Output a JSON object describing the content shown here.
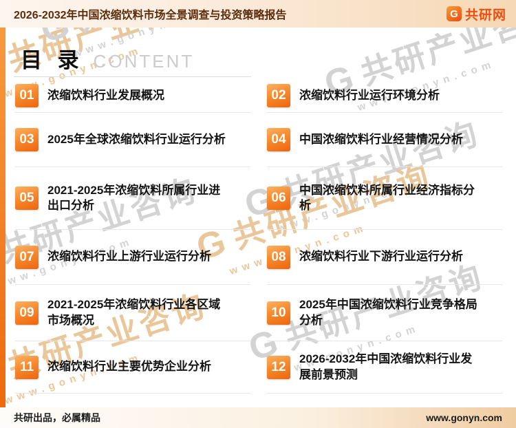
{
  "header": {
    "title": "2026-2032年中国浓缩饮料市场全景调查与投资策略报告",
    "logo_glyph": "G",
    "brand": "共研网"
  },
  "toc": {
    "heading": "目 录",
    "heading_en": "CONTENT",
    "items": [
      {
        "num": "01",
        "label": "浓缩饮料行业发展概况"
      },
      {
        "num": "02",
        "label": "浓缩饮料行业运行环境分析"
      },
      {
        "num": "03",
        "label": "2025年全球浓缩饮料行业运行分析"
      },
      {
        "num": "04",
        "label": "中国浓缩饮料行业经营情况分析"
      },
      {
        "num": "05",
        "label": "2021-2025年浓缩饮料所属行业进出口分析"
      },
      {
        "num": "06",
        "label": "中国浓缩饮料所属行业经济指标分析"
      },
      {
        "num": "07",
        "label": "浓缩饮料行业上游行业运行分析"
      },
      {
        "num": "08",
        "label": "浓缩饮料行业下游行业运行分析"
      },
      {
        "num": "09",
        "label": "2021-2025年浓缩饮料行业各区域市场概况"
      },
      {
        "num": "10",
        "label": "2025年中国浓缩饮料行业竞争格局分析"
      },
      {
        "num": "11",
        "label": "浓缩饮料行业主要优势企业分析"
      },
      {
        "num": "12",
        "label": "2026-2032年中国浓缩饮料行业发展前景预测"
      }
    ]
  },
  "watermark": {
    "glyph": "G",
    "brand": "共研产业咨询",
    "url": "www.gonyn.com"
  },
  "footer": {
    "left": "共研出品，必属精品",
    "right": "www.gonyn.com"
  },
  "colors": {
    "accent": "#ef650c",
    "header_text": "#5b2c0d"
  }
}
